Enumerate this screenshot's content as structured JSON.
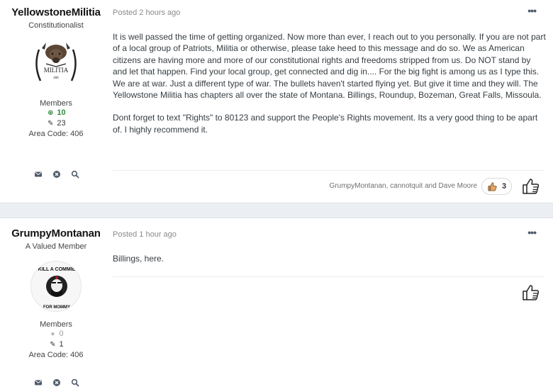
{
  "posts": [
    {
      "author": {
        "name": "YellowstoneMilitia",
        "title": "Constitutionalist",
        "avatar_text": "MILITIA",
        "avatar_small_text": "406",
        "group": "Members",
        "reputation": "10",
        "post_count": "23",
        "area": "Area Code: 406"
      },
      "meta": "Posted 2 hours ago",
      "more_label": "•••",
      "paragraphs": [
        "It is well passed the time of getting organized. Now more than ever, I reach out to you personally. If you are not part of a local group of Patriots, Militia or otherwise, please take heed to this message and do so. We as American citizens are having more and more of our constitutional rights and freedoms stripped from us. Do NOT stand by and let that happen. Find your local group, get connected and dig in.... For the big fight is among us as I type this. We are at war. Just a different type of war. The bullets haven't started flying yet. But give it time and they will. The Yellowstone Militia has chapters all over the state of Montana. Billings, Roundup, Bozeman, Great Falls, Missoula.",
        "Dont forget to text \"Rights\" to 80123 and support the People's Rights movement. Its a very good thing to be apart of. I highly recommend it."
      ],
      "reactions": {
        "reactors": "GrumpyMontanan, cannotquit and Dave Moore",
        "count": "3"
      }
    },
    {
      "author": {
        "name": "GrumpyMontanan",
        "title": "A Valued Member",
        "avatar_text_top": "KILL A COMMIE",
        "avatar_text_bottom": "FOR MOMMY",
        "group": "Members",
        "reputation": "0",
        "post_count": "1",
        "area": "Area Code: 406"
      },
      "meta": "Posted 1 hour ago",
      "more_label": "•••",
      "paragraphs": [
        "Billings, here."
      ]
    }
  ],
  "icons": {
    "message": "envelope-icon",
    "block": "block-icon",
    "search": "search-icon",
    "like": "thumbs-up-icon",
    "reaction": "thumbs-up-reaction-icon",
    "rep_positive": "plus-circle-icon",
    "rep_neutral": "circle-icon",
    "posts": "pencil-icon"
  },
  "colors": {
    "background": "#ebeef2",
    "reputation_positive": "#2e8a3e",
    "author_name": "#141414",
    "icon": "#4f5b6b"
  }
}
